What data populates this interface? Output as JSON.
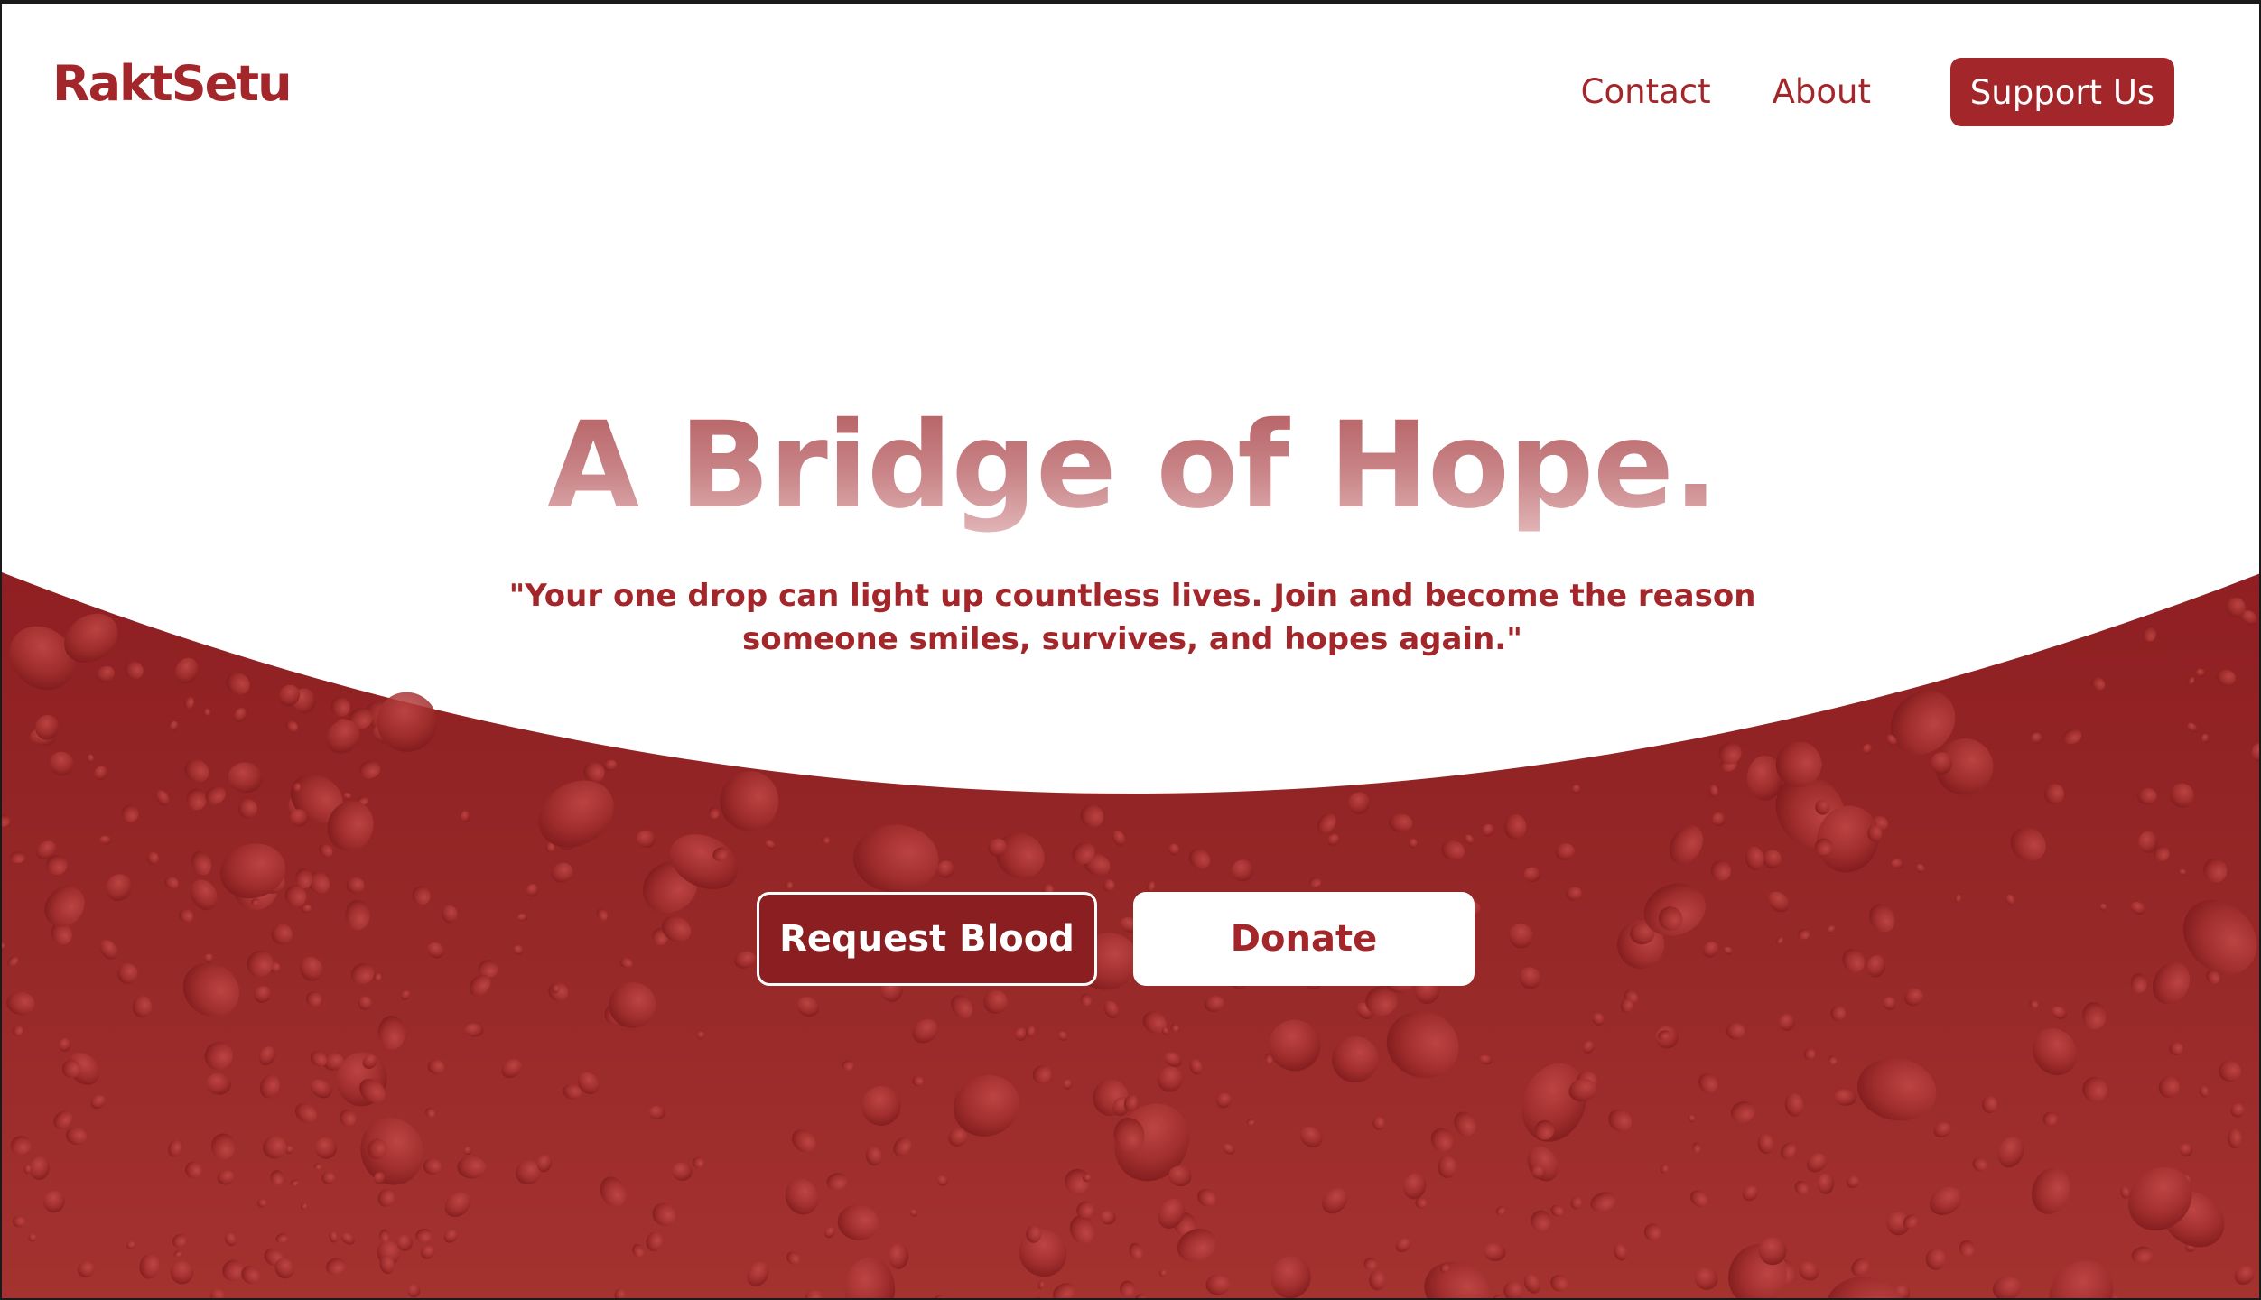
{
  "brand": {
    "logo_text": "RaktSetu",
    "primary_color": "#a3262a",
    "dark_red": "#8b1e21",
    "background_red": "#952627"
  },
  "nav": {
    "links": [
      {
        "label": "Contact"
      },
      {
        "label": "About"
      }
    ],
    "support_label": "Support Us"
  },
  "hero": {
    "title": "A Bridge of Hope.",
    "quote_line1": "\"Your one drop can light up countless lives. Join and become the reason",
    "quote_line2": "someone smiles, survives, and hopes again.\"",
    "background_image": "blood-droplets-texture"
  },
  "cta": {
    "request_label": "Request Blood",
    "donate_label": "Donate"
  }
}
